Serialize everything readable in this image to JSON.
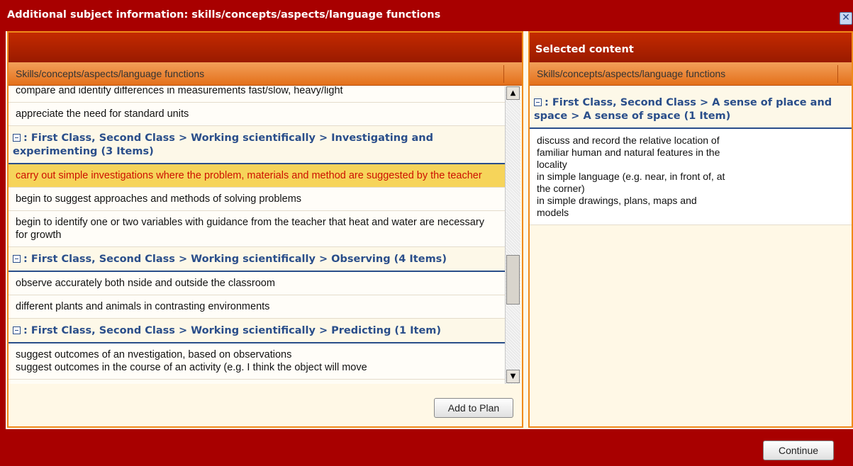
{
  "dialog": {
    "title": "Additional subject information: skills/concepts/aspects/language functions",
    "close_label": "✕"
  },
  "left": {
    "column_header": "Skills/concepts/aspects/language functions",
    "rows": [
      {
        "type": "item",
        "text": "compare and identify differences in measurements fast/slow, heavy/light",
        "selected": false
      },
      {
        "type": "item",
        "text": "appreciate the need for standard units",
        "selected": false
      },
      {
        "type": "group",
        "text": ": First Class, Second Class > Working scientifically > Investigating and experimenting (3 Items)"
      },
      {
        "type": "item",
        "text": "carry out simple investigations where the problem, materials and method are suggested by the teacher",
        "selected": true
      },
      {
        "type": "item",
        "text": "begin to suggest approaches and methods of solving problems",
        "selected": false
      },
      {
        "type": "item",
        "text": "begin to identify one or two variables with guidance from the teacher that heat and water are necessary for growth",
        "selected": false
      },
      {
        "type": "group",
        "text": ": First Class, Second Class > Working scientifically > Observing (4 Items)"
      },
      {
        "type": "item",
        "text": "observe accurately both nside and outside the classroom",
        "selected": false
      },
      {
        "type": "item",
        "text": "different plants and animals in contrasting environments",
        "selected": false
      },
      {
        "type": "group",
        "text": ": First Class, Second Class > Working scientifically > Predicting (1 Item)"
      },
      {
        "type": "item",
        "text": "suggest outcomes of an nvestigation, based on observations\nsuggest outcomes in the course of an activity (e.g. I think the object will move",
        "selected": false
      }
    ],
    "add_button": "Add to Plan"
  },
  "right": {
    "header": "Selected content",
    "column_header": "Skills/concepts/aspects/language functions",
    "group": ": First Class, Second Class > A sense of place and space > A sense of space (1 Item)",
    "item": "discuss and record the relative location of\nfamiliar human and natural features in the\nlocality\nin simple language (e.g. near, in front of, at\nthe corner)\nin simple drawings, plans, maps and\nmodels"
  },
  "footer": {
    "continue_button": "Continue"
  },
  "colors": {
    "frame": "#a80000",
    "accent_orange": "#f08a1a",
    "group_blue": "#2a4e8a",
    "selected_bg": "#f6d45a",
    "selected_text": "#cc1100"
  },
  "icons": {
    "close": "close-icon",
    "collapse": "minus-box-icon",
    "scroll_up": "arrow-up-icon",
    "scroll_down": "arrow-down-icon"
  }
}
